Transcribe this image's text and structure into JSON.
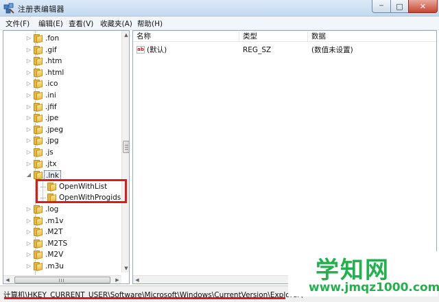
{
  "window": {
    "title": "注册表编辑器",
    "app_icon": "regedit-icon",
    "controls": {
      "minimize": "─",
      "maximize": "□",
      "close": "✕"
    }
  },
  "menu": [
    "文件(F)",
    "编辑(E)",
    "查看(V)",
    "收藏夹(A)",
    "帮助(H)"
  ],
  "tree": {
    "items": [
      {
        "label": ".fon",
        "level": 1,
        "expander": "▷"
      },
      {
        "label": ".gif",
        "level": 1,
        "expander": "▷"
      },
      {
        "label": ".htm",
        "level": 1,
        "expander": "▷"
      },
      {
        "label": ".html",
        "level": 1,
        "expander": "▷"
      },
      {
        "label": ".ico",
        "level": 1,
        "expander": "▷"
      },
      {
        "label": ".ini",
        "level": 1,
        "expander": "▷"
      },
      {
        "label": ".jfif",
        "level": 1,
        "expander": "▷"
      },
      {
        "label": ".jpe",
        "level": 1,
        "expander": "▷"
      },
      {
        "label": ".jpeg",
        "level": 1,
        "expander": "▷"
      },
      {
        "label": ".jpg",
        "level": 1,
        "expander": "▷"
      },
      {
        "label": ".js",
        "level": 1,
        "expander": "▷"
      },
      {
        "label": ".jtx",
        "level": 1,
        "expander": "▷"
      },
      {
        "label": ".lnk",
        "level": 1,
        "expander": "◢",
        "selected": true
      },
      {
        "label": "OpenWithList",
        "level": 2,
        "expander": ""
      },
      {
        "label": "OpenWithProgids",
        "level": 2,
        "expander": ""
      },
      {
        "label": ".log",
        "level": 1,
        "expander": "▷"
      },
      {
        "label": ".m1v",
        "level": 1,
        "expander": "▷"
      },
      {
        "label": ".M2T",
        "level": 1,
        "expander": "▷"
      },
      {
        "label": ".M2TS",
        "level": 1,
        "expander": "▷"
      },
      {
        "label": ".M2V",
        "level": 1,
        "expander": "▷"
      },
      {
        "label": ".m3u",
        "level": 1,
        "expander": "▷"
      }
    ]
  },
  "list": {
    "columns": [
      "名称",
      "类型",
      "数据"
    ],
    "rows": [
      {
        "name": "(默认)",
        "type": "REG_SZ",
        "data": "(数值未设置)",
        "icon": "ab"
      }
    ]
  },
  "status": {
    "path": "计算机\\HKEY_CURRENT_USER\\Software\\Microsoft\\Windows\\CurrentVersion\\Explorer\\"
  },
  "watermark": {
    "big": "学知网",
    "small": "www.jmqz1000.com"
  },
  "colors": {
    "annotation_red": "#e01818",
    "watermark_green": "#22b14c",
    "folder": "#e6b645"
  }
}
